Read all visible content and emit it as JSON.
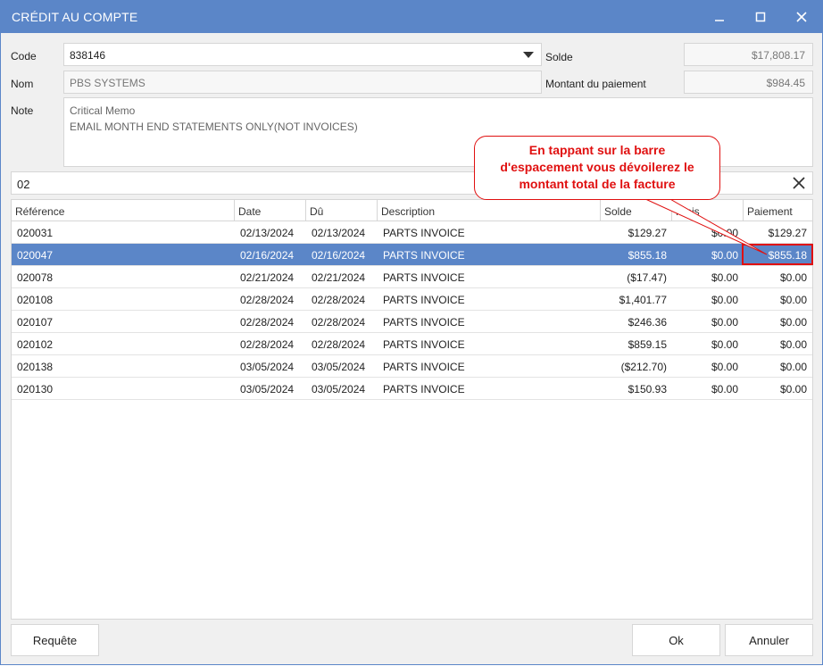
{
  "window": {
    "title": "CRÉDIT AU COMPTE",
    "controls": {
      "minimize": "–",
      "maximize": "☐",
      "close": "✕"
    }
  },
  "form": {
    "code_label": "Code",
    "code_value": "838146",
    "nom_label": "Nom",
    "nom_value": "PBS SYSTEMS",
    "note_label": "Note",
    "note_lines": [
      "Critical Memo",
      "EMAIL MONTH END STATEMENTS ONLY(NOT INVOICES)"
    ],
    "solde_label": "Solde",
    "solde_value": "$17,808.17",
    "montant_label": "Montant du paiement",
    "montant_value": "$984.45"
  },
  "search": {
    "value": "02"
  },
  "grid": {
    "headers": [
      "Référence",
      "Date",
      "Dû",
      "Description",
      "Solde",
      "Frais",
      "Paiement"
    ],
    "rows": [
      [
        "020031",
        "02/13/2024",
        "02/13/2024",
        "PARTS INVOICE",
        "$129.27",
        "$0.00",
        "$129.27"
      ],
      [
        "020047",
        "02/16/2024",
        "02/16/2024",
        "PARTS INVOICE",
        "$855.18",
        "$0.00",
        "$855.18"
      ],
      [
        "020078",
        "02/21/2024",
        "02/21/2024",
        "PARTS INVOICE",
        "($17.47)",
        "$0.00",
        "$0.00"
      ],
      [
        "020108",
        "02/28/2024",
        "02/28/2024",
        "PARTS INVOICE",
        "$1,401.77",
        "$0.00",
        "$0.00"
      ],
      [
        "020107",
        "02/28/2024",
        "02/28/2024",
        "PARTS INVOICE",
        "$246.36",
        "$0.00",
        "$0.00"
      ],
      [
        "020102",
        "02/28/2024",
        "02/28/2024",
        "PARTS INVOICE",
        "$859.15",
        "$0.00",
        "$0.00"
      ],
      [
        "020138",
        "03/05/2024",
        "03/05/2024",
        "PARTS INVOICE",
        "($212.70)",
        "$0.00",
        "$0.00"
      ],
      [
        "020130",
        "03/05/2024",
        "03/05/2024",
        "PARTS INVOICE",
        "$150.93",
        "$0.00",
        "$0.00"
      ]
    ]
  },
  "callout": {
    "lines": [
      "En tappant sur la barre",
      "d'espacement vous dévoilerez le",
      "montant total de la facture"
    ]
  },
  "buttons": {
    "requete": "Requête",
    "ok": "Ok",
    "annuler": "Annuler"
  },
  "colors": {
    "accent": "#5b86c8",
    "callout": "#e01010"
  }
}
